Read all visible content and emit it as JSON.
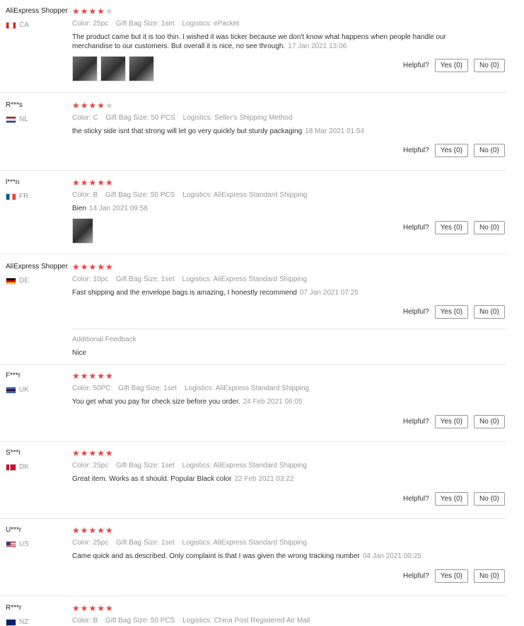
{
  "helpful_label": "Helpful?",
  "colors": {
    "star": "#e64545",
    "star_empty": "#cccccc"
  },
  "reviews": [
    {
      "user": "AliExpress Shopper",
      "country": "CA",
      "rating": 4,
      "attrs": [
        [
          "Color:",
          "25pc"
        ],
        [
          "Gift Bag Size:",
          "1set"
        ],
        [
          "Logistics:",
          "ePacket"
        ]
      ],
      "text": "The product came but it is too thin. I wished it was ticker because we don't know what happens when people handle our merchandise to our customers. But overall it is nice, no see through.",
      "date": "17 Jan 2021 13:06",
      "yes": "Yes (0)",
      "no": "No (0)",
      "photos": 3
    },
    {
      "user": "R***s",
      "country": "NL",
      "rating": 4,
      "attrs": [
        [
          "Color:",
          "C"
        ],
        [
          "Gift Bag Size:",
          "50 PCS"
        ],
        [
          "Logistics:",
          "Seller's Shipping Method"
        ]
      ],
      "text": "the sticky side isnt that strong will let go very quickly but sturdy packaging",
      "date": "18 Mar 2021 01:54",
      "yes": "Yes (0)",
      "no": "No (0)"
    },
    {
      "user": "l***n",
      "country": "FR",
      "rating": 5,
      "attrs": [
        [
          "Color:",
          "B"
        ],
        [
          "Gift Bag Size:",
          "50 PCS"
        ],
        [
          "Logistics:",
          "AliExpress Standard Shipping"
        ]
      ],
      "text": "Bien",
      "date": "14 Jan 2021 09:58",
      "yes": "Yes (0)",
      "no": "No (0)",
      "photos": 1
    },
    {
      "user": "AliExpress Shopper",
      "country": "DE",
      "rating": 5,
      "attrs": [
        [
          "Color:",
          "10pc"
        ],
        [
          "Gift Bag Size:",
          "1set"
        ],
        [
          "Logistics:",
          "AliExpress Standard Shipping"
        ]
      ],
      "text": "Fast shipping and the envelope bags is amazing, I honestly recommend",
      "date": "07 Jan 2021 07:25",
      "yes": "Yes (0)",
      "no": "No (0)",
      "additional_feedback_title": "Additional Feedback",
      "additional_feedback": "Nice"
    },
    {
      "user": "F***r",
      "country": "UK",
      "rating": 5,
      "attrs": [
        [
          "Color:",
          "50PC"
        ],
        [
          "Gift Bag Size:",
          "1set"
        ],
        [
          "Logistics:",
          "AliExpress Standard Shipping"
        ]
      ],
      "text": "You get what you pay for check size before you order.",
      "date": "24 Feb 2021 06:05",
      "yes": "Yes (0)",
      "no": "No (0)"
    },
    {
      "user": "S***i",
      "country": "DK",
      "rating": 5,
      "attrs": [
        [
          "Color:",
          "25pc"
        ],
        [
          "Gift Bag Size:",
          "1set"
        ],
        [
          "Logistics:",
          "AliExpress Standard Shipping"
        ]
      ],
      "text": "Great item. Works as it should. Popular Black color",
      "date": "22 Feb 2021 03:22",
      "yes": "Yes (0)",
      "no": "No (0)"
    },
    {
      "user": "U***r",
      "country": "US",
      "rating": 5,
      "attrs": [
        [
          "Color:",
          "25pc"
        ],
        [
          "Gift Bag Size:",
          "1set"
        ],
        [
          "Logistics:",
          "AliExpress Standard Shipping"
        ]
      ],
      "text": "Came quick and as described. Only complaint is that I was given the wrong tracking number",
      "date": "04 Jan 2021 00:25",
      "yes": "Yes (0)",
      "no": "No (0)"
    },
    {
      "user": "R***r",
      "country": "NZ",
      "rating": 5,
      "attrs": [
        [
          "Color:",
          "B"
        ],
        [
          "Gift Bag Size:",
          "50 PCS"
        ],
        [
          "Logistics:",
          "China Post Registered Air Mail"
        ]
      ]
    }
  ]
}
